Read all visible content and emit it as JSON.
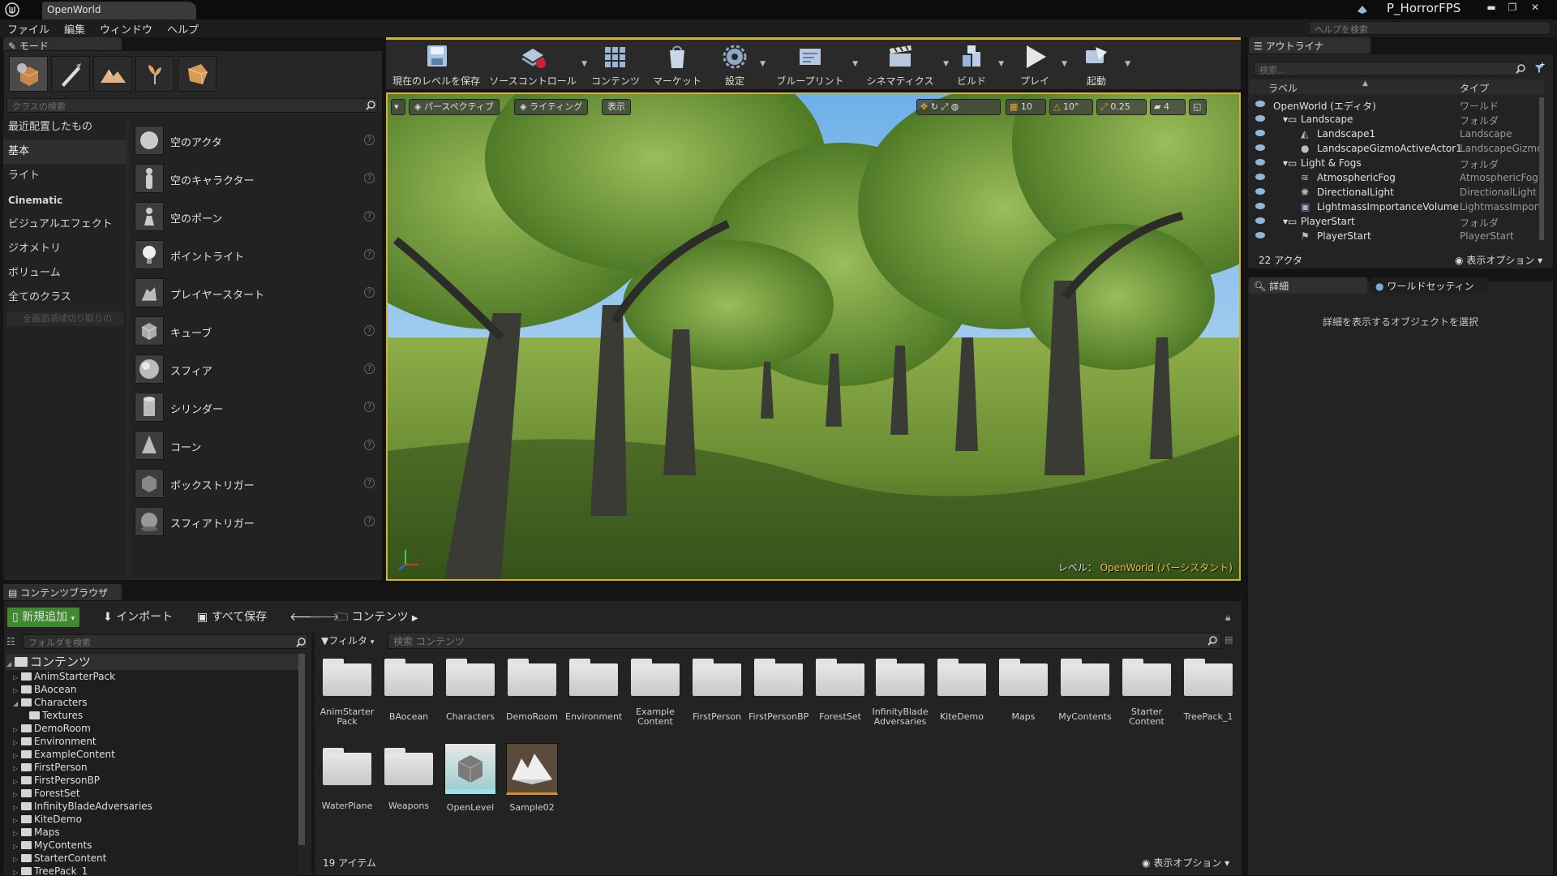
{
  "window": {
    "doc_tab": "OpenWorld",
    "project": "P_HorrorFPS",
    "min": "▬",
    "restore": "❐",
    "close": "✕"
  },
  "menu": [
    "ファイル",
    "編集",
    "ウィンドウ",
    "ヘルプ"
  ],
  "help_search": {
    "placeholder": "ヘルプを検索"
  },
  "modes": {
    "tab": "モード",
    "search_placeholder": "クラスの検索",
    "categories": [
      "最近配置したもの",
      "基本",
      "ライト",
      "Cinematic",
      "ビジュアルエフェクト",
      "ジオメトリ",
      "ボリューム",
      "全てのクラス"
    ],
    "dragzone": "全画面領域切り取りの",
    "actors": [
      "空のアクタ",
      "空のキャラクター",
      "空のポーン",
      "ポイントライト",
      "プレイヤースタート",
      "キューブ",
      "スフィア",
      "シリンダー",
      "コーン",
      "ボックストリガー",
      "スフィアトリガー"
    ]
  },
  "toolbar": [
    "現在のレベルを保存",
    "ソースコントロール",
    "コンテンツ",
    "マーケット",
    "設定",
    "ブループリント",
    "シネマティクス",
    "ビルド",
    "プレイ",
    "起動"
  ],
  "viewport": {
    "perspective": "パースペクティブ",
    "lighting": "ライティング",
    "show": "表示",
    "grid_snap": "10",
    "rot_snap": "10°",
    "scale_snap": "0.25",
    "cam_speed": "4",
    "level_label": "レベル：",
    "level_name": "OpenWorld (パーシスタント)"
  },
  "outliner": {
    "tab": "アウトライナ",
    "search_placeholder": "検索...",
    "col_label": "ラベル",
    "col_type": "タイプ",
    "rows": [
      {
        "name": "OpenWorld (エディタ)",
        "type": "ワールド"
      },
      {
        "name": "Landscape",
        "type": "フォルダ"
      },
      {
        "name": "Landscape1",
        "type": "Landscape"
      },
      {
        "name": "LandscapeGizmoActiveActor1",
        "type": "LandscapeGizmo..."
      },
      {
        "name": "Light & Fogs",
        "type": "フォルダ"
      },
      {
        "name": "AtmosphericFog",
        "type": "AtmosphericFog"
      },
      {
        "name": "DirectionalLight",
        "type": "DirectionalLight"
      },
      {
        "name": "LightmassImportanceVolume",
        "type": "LightmassImporta"
      },
      {
        "name": "PlayerStart",
        "type": "フォルダ"
      },
      {
        "name": "PlayerStart",
        "type": "PlayerStart"
      }
    ],
    "count": "22 アクタ",
    "view_options": "表示オプション"
  },
  "details": {
    "tab": "詳細",
    "world_tab": "ワールドセッティン",
    "empty": "詳細を表示するオブジェクトを選択"
  },
  "content_browser": {
    "tab": "コンテンツブラウザ",
    "add_new": "新規追加",
    "import": "インポート",
    "save_all": "すべて保存",
    "path": "コンテンツ",
    "folder_search": "フォルダを検索",
    "filter": "フィルタ",
    "search_placeholder": "検索 コンテンツ",
    "tree_root": "コンテンツ",
    "tree": [
      "AnimStarterPack",
      "BAocean",
      "Characters",
      "Textures",
      "DemoRoom",
      "Environment",
      "ExampleContent",
      "FirstPerson",
      "FirstPersonBP",
      "ForestSet",
      "InfinityBladeAdversaries",
      "KiteDemo",
      "Maps",
      "MyContents",
      "StarterContent",
      "TreePack_1"
    ],
    "assets": [
      "AnimStarter Pack",
      "BAocean",
      "Characters",
      "DemoRoom",
      "Environment",
      "Example Content",
      "FirstPerson",
      "FirstPersonBP",
      "ForestSet",
      "InfinityBlade Adversaries",
      "KiteDemo",
      "Maps",
      "MyContents",
      "Starter Content",
      "TreePack_1",
      "WaterPlane",
      "Weapons",
      "OpenLevel",
      "Sample02"
    ],
    "count": "19 アイテム",
    "view_options": "表示オプション"
  },
  "colors": {
    "accent": "#d4b23a",
    "add_new": "#3f8a2e",
    "panel": "#232323"
  }
}
